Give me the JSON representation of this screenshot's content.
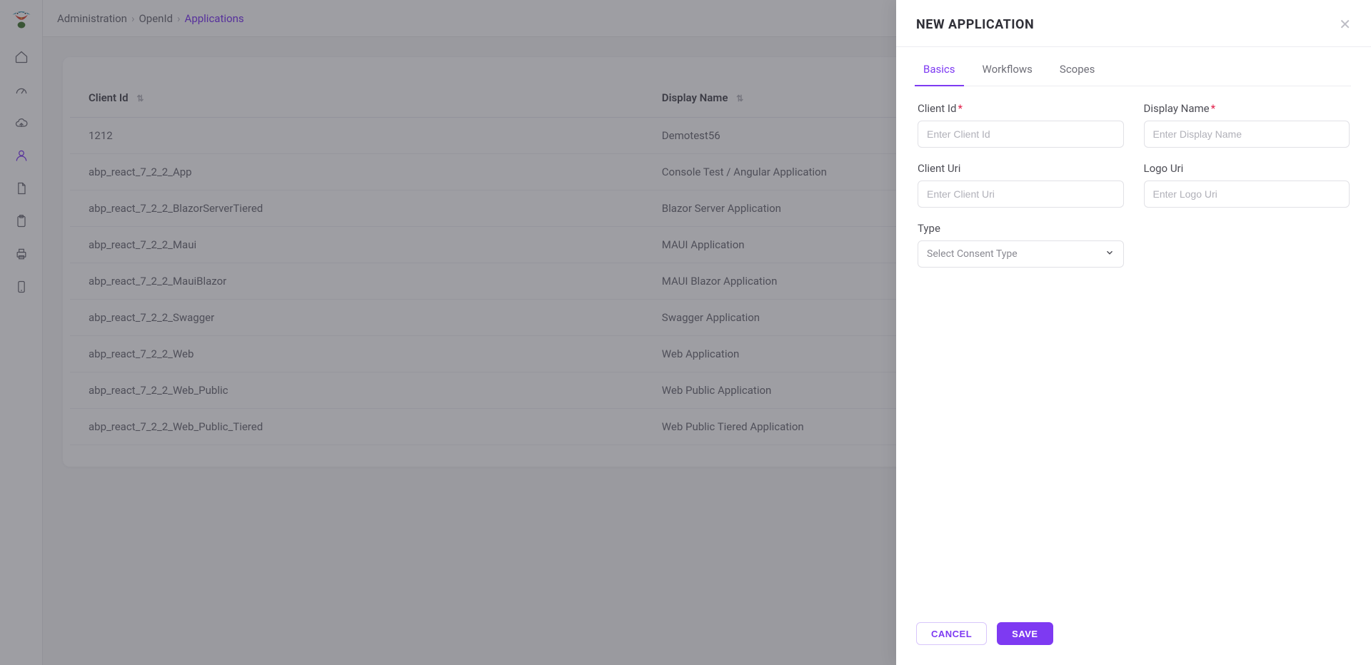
{
  "breadcrumb": {
    "a": "Administration",
    "b": "OpenId",
    "c": "Applications"
  },
  "columns": {
    "clientId": "Client Id",
    "displayName": "Display Name"
  },
  "rows": [
    {
      "clientId": "1212",
      "displayName": "Demotest56"
    },
    {
      "clientId": "abp_react_7_2_2_App",
      "displayName": "Console Test / Angular Application"
    },
    {
      "clientId": "abp_react_7_2_2_BlazorServerTiered",
      "displayName": "Blazor Server Application"
    },
    {
      "clientId": "abp_react_7_2_2_Maui",
      "displayName": "MAUI Application"
    },
    {
      "clientId": "abp_react_7_2_2_MauiBlazor",
      "displayName": "MAUI Blazor Application"
    },
    {
      "clientId": "abp_react_7_2_2_Swagger",
      "displayName": "Swagger Application"
    },
    {
      "clientId": "abp_react_7_2_2_Web",
      "displayName": "Web Application"
    },
    {
      "clientId": "abp_react_7_2_2_Web_Public",
      "displayName": "Web Public Application"
    },
    {
      "clientId": "abp_react_7_2_2_Web_Public_Tiered",
      "displayName": "Web Public Tiered Application"
    }
  ],
  "drawer": {
    "title": "NEW APPLICATION",
    "tabs": {
      "basics": "Basics",
      "workflows": "Workflows",
      "scopes": "Scopes"
    },
    "fields": {
      "clientId": {
        "label": "Client Id",
        "placeholder": "Enter Client Id",
        "required": true
      },
      "displayName": {
        "label": "Display Name",
        "placeholder": "Enter Display Name",
        "required": true
      },
      "clientUri": {
        "label": "Client Uri",
        "placeholder": "Enter Client Uri",
        "required": false
      },
      "logoUri": {
        "label": "Logo Uri",
        "placeholder": "Enter Logo Uri",
        "required": false
      },
      "type": {
        "label": "Type",
        "placeholder": "Select Consent Type",
        "required": false
      }
    },
    "buttons": {
      "cancel": "CANCEL",
      "save": "SAVE"
    }
  }
}
